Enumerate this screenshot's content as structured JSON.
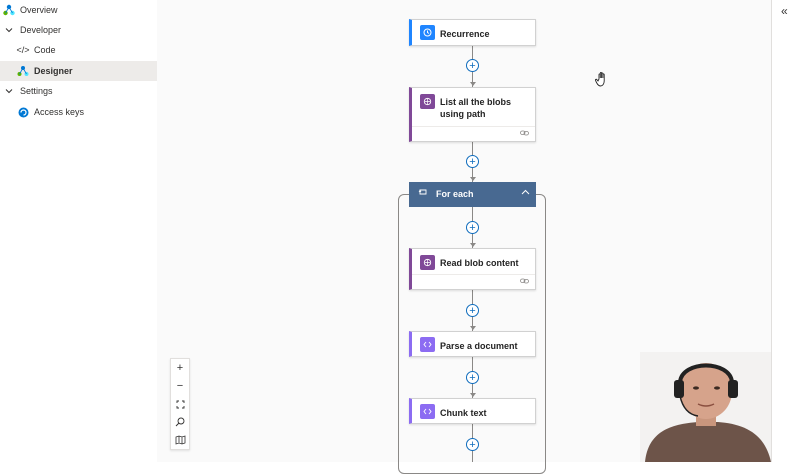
{
  "sidebar": {
    "items": [
      {
        "label": "Overview",
        "icon": "overview-icon"
      },
      {
        "label": "Developer",
        "icon": "chevron-down-icon"
      },
      {
        "label": "Code",
        "icon": "code-icon"
      },
      {
        "label": "Designer",
        "icon": "designer-icon"
      },
      {
        "label": "Settings",
        "icon": "chevron-down-icon"
      },
      {
        "label": "Access keys",
        "icon": "access-keys-icon"
      }
    ],
    "selected": "Designer"
  },
  "workflow": {
    "recurrence": {
      "title": "Recurrence",
      "icon": "clock-icon"
    },
    "list_blobs": {
      "title": "List all the blobs using path",
      "icon": "blob-storage-icon"
    },
    "for_each": {
      "title": "For each",
      "icon": "loop-icon"
    },
    "read_blob": {
      "title": "Read blob content",
      "icon": "blob-storage-icon"
    },
    "parse_document": {
      "title": "Parse a document",
      "icon": "data-operation-icon"
    },
    "chunk_text": {
      "title": "Chunk text",
      "icon": "data-operation-icon"
    }
  },
  "controls": {
    "zoom_in": "+",
    "zoom_out": "−",
    "collapse": "«"
  },
  "colors": {
    "accent": "#0f6cbd",
    "blob_action": "#804998",
    "data_operation": "#8c6cf2",
    "for_each_header": "#486991",
    "recurrence": "#1f85ff"
  }
}
